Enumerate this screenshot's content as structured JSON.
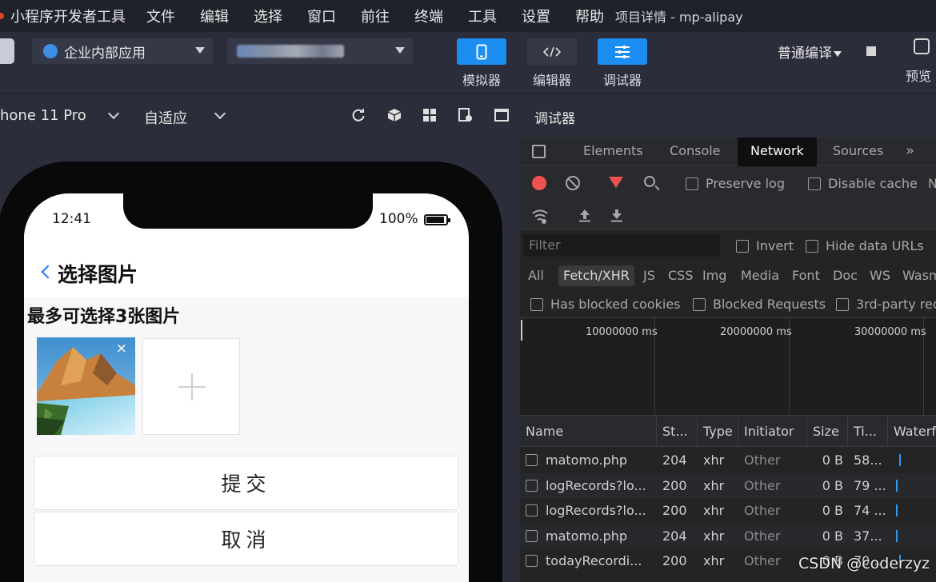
{
  "menubar": {
    "app_name": "小程序开发者工具",
    "items": [
      "文件",
      "编辑",
      "选择",
      "窗口",
      "前往",
      "终端",
      "工具",
      "设置",
      "帮助"
    ],
    "project_title": "项目详情 - mp-alipay"
  },
  "toolbar": {
    "app_select": "企业内部应用",
    "tools": [
      {
        "label": "模拟器",
        "icon": "phone-icon"
      },
      {
        "label": "编辑器",
        "icon": "code-icon"
      },
      {
        "label": "调试器",
        "icon": "sliders-icon"
      }
    ],
    "compile_label": "普通编译",
    "preview_label": "预览"
  },
  "secbar": {
    "device": "hone 11 Pro",
    "zoom": "自适应",
    "debugger_label": "调试器"
  },
  "phone": {
    "time": "12:41",
    "battery": "100%",
    "nav_title": "选择图片",
    "section_title": "最多可选择3张图片",
    "close_glyph": "×",
    "submit": "提交",
    "cancel": "取消"
  },
  "devtools": {
    "tabs": [
      "Elements",
      "Console",
      "Network",
      "Sources"
    ],
    "more": "»",
    "active_tab": "Network",
    "preserve_log": "Preserve log",
    "disable_cache": "Disable cache",
    "cut_n": "N",
    "filter_placeholder": "Filter",
    "invert": "Invert",
    "hide_data_urls": "Hide data URLs",
    "types": [
      "All",
      "Fetch/XHR",
      "JS",
      "CSS",
      "Img",
      "Media",
      "Font",
      "Doc",
      "WS",
      "Wasm"
    ],
    "has_blocked_cookies": "Has blocked cookies",
    "blocked_requests": "Blocked Requests",
    "third_party": "3rd-party rec",
    "overview_ticks": [
      "10000000 ms",
      "20000000 ms",
      "30000000 ms"
    ],
    "columns": [
      "Name",
      "St...",
      "Type",
      "Initiator",
      "Size",
      "Ti...",
      "Waterf"
    ],
    "rows": [
      {
        "name": "matomo.php",
        "status": "204",
        "type": "xhr",
        "initiator": "Other",
        "size": "0 B",
        "time": "58..."
      },
      {
        "name": "logRecords?lo...",
        "status": "200",
        "type": "xhr",
        "initiator": "Other",
        "size": "0 B",
        "time": "79 ..."
      },
      {
        "name": "logRecords?lo...",
        "status": "200",
        "type": "xhr",
        "initiator": "Other",
        "size": "0 B",
        "time": "74 ..."
      },
      {
        "name": "matomo.php",
        "status": "204",
        "type": "xhr",
        "initiator": "Other",
        "size": "0 B",
        "time": "37..."
      },
      {
        "name": "todayRecordi...",
        "status": "200",
        "type": "xhr",
        "initiator": "Other",
        "size": "0 B",
        "time": "70..."
      }
    ]
  },
  "watermark": "CSDN @coderzyz",
  "colors": {
    "accent": "#1c8df1",
    "record": "#ef5350",
    "back_arrow": "#1677ff"
  }
}
